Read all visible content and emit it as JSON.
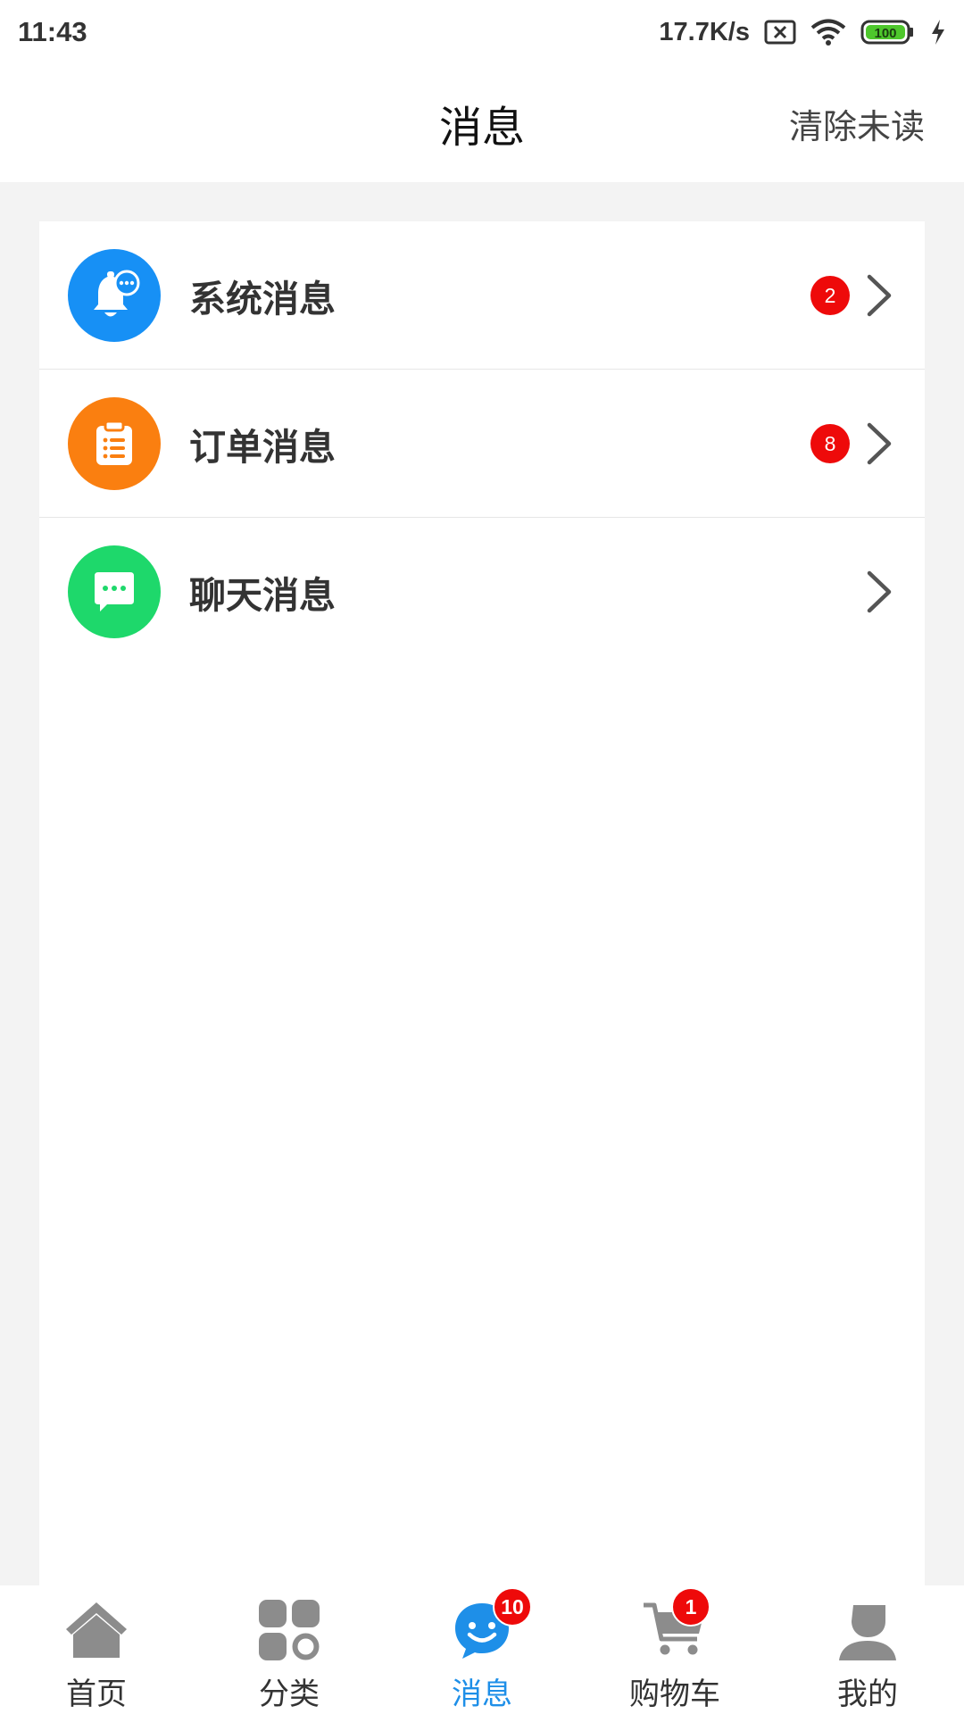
{
  "status_bar": {
    "time": "11:43",
    "network_speed": "17.7K/s",
    "battery_level": "100",
    "icons": [
      "no-sim-icon",
      "wifi-icon",
      "battery-icon",
      "charging-icon"
    ]
  },
  "header": {
    "title": "消息",
    "action_label": "清除未读"
  },
  "messages": [
    {
      "label": "系统消息",
      "icon": "bell-icon",
      "icon_color": "#1790f5",
      "badge": "2"
    },
    {
      "label": "订单消息",
      "icon": "clipboard-icon",
      "icon_color": "#fa7f10",
      "badge": "8"
    },
    {
      "label": "聊天消息",
      "icon": "chat-icon",
      "icon_color": "#1ed86b",
      "badge": null
    }
  ],
  "tabbar": {
    "tabs": [
      {
        "label": "首页",
        "icon": "home-icon",
        "badge": null,
        "active": false
      },
      {
        "label": "分类",
        "icon": "category-icon",
        "badge": null,
        "active": false
      },
      {
        "label": "消息",
        "icon": "message-icon",
        "badge": "10",
        "active": true
      },
      {
        "label": "购物车",
        "icon": "cart-icon",
        "badge": "1",
        "active": false
      },
      {
        "label": "我的",
        "icon": "profile-icon",
        "badge": null,
        "active": false
      }
    ]
  },
  "colors": {
    "accent": "#1e8fe8",
    "badge": "#ee0a0a",
    "background": "#f3f3f3"
  }
}
